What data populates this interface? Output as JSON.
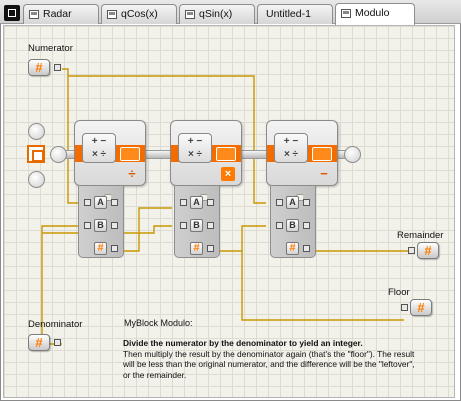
{
  "tabs": [
    {
      "label": "Radar",
      "active": false
    },
    {
      "label": "qCos(x)",
      "active": false
    },
    {
      "label": "qSin(x)",
      "active": false
    },
    {
      "label": "Untitled-1",
      "active": false
    },
    {
      "label": "Modulo",
      "active": true
    }
  ],
  "canvas": {
    "numerator_label": "Numerator",
    "denominator_label": "Denominator",
    "remainder_label": "Remainder",
    "floor_label": "Floor",
    "number_glyph": "#",
    "blocks": [
      {
        "operation": "divide",
        "op_glyph": "÷"
      },
      {
        "operation": "multiply",
        "op_glyph": "×"
      },
      {
        "operation": "subtract",
        "op_glyph": "−"
      }
    ],
    "hub_plugs": [
      "A",
      "B",
      "#"
    ],
    "math_icon_glyphs": "+ −\n× ÷"
  },
  "description": {
    "title": "MyBlock Modulo:",
    "lead": "Divide the numerator by the denominator to yield an integer.",
    "body": "Then multiply the result by the denominator again (that's the \"floor\"). The result will be less than the original numerator, and the difference will be the \"leftover\", or the remainder."
  },
  "colors": {
    "wire": "#c99700",
    "accent": "#f26c00"
  }
}
